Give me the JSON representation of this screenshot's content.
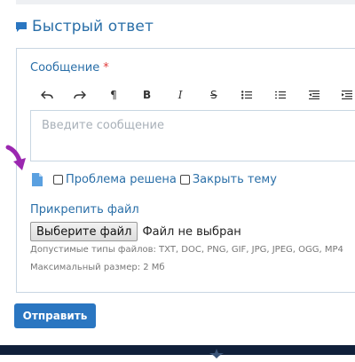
{
  "quick_reply": {
    "title": "Быстрый ответ",
    "message_label": "Сообщение",
    "required_mark": "*",
    "editor_placeholder": "Введите сообщение",
    "toolbar_icons": [
      "undo-icon",
      "redo-icon",
      "paragraph-icon",
      "bold-icon",
      "italic-icon",
      "strikethrough-icon",
      "bullet-list-icon",
      "numbered-list-icon",
      "outdent-icon",
      "indent-icon"
    ],
    "toolbar_glyphs": {
      "paragraph": "¶",
      "bold": "B",
      "italic": "I",
      "strike": "S"
    },
    "checkbox_solved": "Проблема решена",
    "checkbox_close": "Закрыть тему",
    "attach_label": "Прикрепить файл",
    "file_button": "Выберите файл",
    "file_status": "Файл не выбран",
    "allowed_types": "Допустимые типы файлов: TXT, DOC, PNG, GIF, JPG, JPEG, OGG, MP4",
    "max_size": "Максимальный размер: 2 Мб",
    "submit_label": "Отправить"
  },
  "colors": {
    "accent": "#2a6fa8",
    "button": "#2a76c1",
    "required": "#e03b3b",
    "annotation_arrow": "#9b27b0",
    "footer": "#10203a"
  }
}
